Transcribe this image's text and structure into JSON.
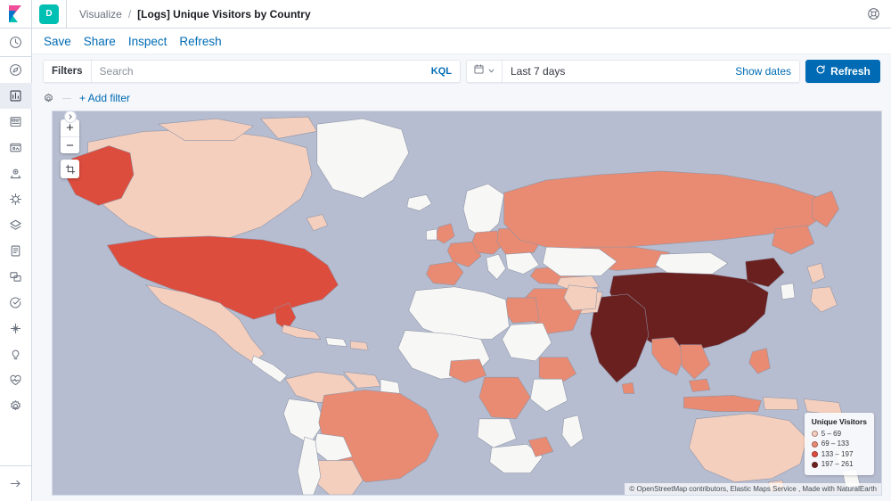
{
  "sidebar": {
    "logo_icon": "kibana-logo-icon",
    "items": [
      {
        "name": "recently-viewed",
        "icon": "clock-icon",
        "active": false
      },
      {
        "name": "discover",
        "icon": "compass-icon",
        "active": false
      },
      {
        "name": "visualize",
        "icon": "bar-chart-icon",
        "active": true
      },
      {
        "name": "dashboard",
        "icon": "dashboard-icon",
        "active": false
      },
      {
        "name": "canvas",
        "icon": "canvas-icon",
        "active": false
      },
      {
        "name": "maps",
        "icon": "map-marker-icon",
        "active": false
      },
      {
        "name": "machine-learning",
        "icon": "machine-learning-icon",
        "active": false
      },
      {
        "name": "infrastructure",
        "icon": "infrastructure-icon",
        "active": false
      },
      {
        "name": "logs",
        "icon": "logs-icon",
        "active": false
      },
      {
        "name": "apm",
        "icon": "apm-icon",
        "active": false
      },
      {
        "name": "uptime",
        "icon": "uptime-icon",
        "active": false
      },
      {
        "name": "siem",
        "icon": "siem-icon",
        "active": false
      },
      {
        "name": "dev-tools",
        "icon": "wrench-icon",
        "active": false
      },
      {
        "name": "monitoring",
        "icon": "heart-pulse-icon",
        "active": false
      },
      {
        "name": "management",
        "icon": "gear-icon",
        "active": false
      }
    ],
    "collapse_icon": "arrow-right-icon"
  },
  "header": {
    "space_badge": "D",
    "breadcrumbs": [
      {
        "label": "Visualize",
        "current": false
      },
      {
        "label": "[Logs] Unique Visitors by Country",
        "current": true
      }
    ],
    "breadcrumb_separator": "/",
    "help_icon": "help-lifebuoy-icon"
  },
  "app_menu": {
    "items": [
      {
        "label": "Save",
        "name": "save"
      },
      {
        "label": "Share",
        "name": "share"
      },
      {
        "label": "Inspect",
        "name": "inspect"
      },
      {
        "label": "Refresh",
        "name": "refresh"
      }
    ]
  },
  "query_bar": {
    "filters_label": "Filters",
    "search_placeholder": "Search",
    "search_value": "",
    "query_language": "KQL",
    "calendar_icon": "calendar-icon",
    "chevron_icon": "chevron-down-icon",
    "time_range": "Last 7 days",
    "show_dates_label": "Show dates",
    "refresh_label": "Refresh",
    "refresh_icon": "refresh-icon",
    "refresh_color": "#006bb4"
  },
  "filter_bar": {
    "settings_icon": "gear-icon",
    "add_filter_label": "+ Add filter"
  },
  "map": {
    "panel_toggle_icon": "chevron-right-circle-icon",
    "zoom_in_label": "+",
    "zoom_out_label": "−",
    "fit_bounds_icon": "crop-fit-icon",
    "ocean_color": "#b6bdd0",
    "no_data_color": "#f7f7f5",
    "attribution": "© OpenStreetMap contributors, Elastic Maps Service , Made with NaturalEarth"
  },
  "legend": {
    "title": "Unique Visitors",
    "bands": [
      {
        "label": "5 – 69",
        "color": "#f4cfbe"
      },
      {
        "label": "69 – 133",
        "color": "#e98b73"
      },
      {
        "label": "133 – 197",
        "color": "#dd4d3e"
      },
      {
        "label": "197 – 261",
        "color": "#6b2020"
      }
    ]
  },
  "chart_data": {
    "type": "map",
    "title": "[Logs] Unique Visitors by Country",
    "metric": "Unique Visitors",
    "legend_bands": [
      "5 – 69",
      "69 – 133",
      "133 – 197",
      "197 – 261"
    ],
    "band_colors": [
      "#f4cfbe",
      "#e98b73",
      "#dd4d3e",
      "#6b2020"
    ],
    "countries": [
      {
        "name": "China",
        "band": 4
      },
      {
        "name": "India",
        "band": 4
      },
      {
        "name": "United States",
        "band": 3
      },
      {
        "name": "Alaska (US)",
        "band": 3
      },
      {
        "name": "Russia",
        "band": 2
      },
      {
        "name": "Canada",
        "band": 1
      },
      {
        "name": "Brazil",
        "band": 2
      },
      {
        "name": "Mexico",
        "band": 1
      },
      {
        "name": "Argentina",
        "band": 1
      },
      {
        "name": "Colombia",
        "band": 1
      },
      {
        "name": "Australia",
        "band": 1
      },
      {
        "name": "Indonesia",
        "band": 2
      },
      {
        "name": "Japan",
        "band": 1
      },
      {
        "name": "Turkey",
        "band": 2
      },
      {
        "name": "Nigeria",
        "band": 2
      },
      {
        "name": "DR Congo",
        "band": 2
      },
      {
        "name": "Ethiopia",
        "band": 2
      },
      {
        "name": "Egypt",
        "band": 2
      },
      {
        "name": "Saudi Arabia",
        "band": 2
      },
      {
        "name": "Spain",
        "band": 2
      },
      {
        "name": "France",
        "band": 2
      },
      {
        "name": "Germany",
        "band": 2
      },
      {
        "name": "Poland",
        "band": 2
      },
      {
        "name": "Ukraine",
        "band": 2
      },
      {
        "name": "Greenland",
        "band": 0
      },
      {
        "name": "Kazakhstan",
        "band": 0
      },
      {
        "name": "Mongolia",
        "band": 0
      },
      {
        "name": "Algeria",
        "band": 0
      },
      {
        "name": "Libya",
        "band": 0
      },
      {
        "name": "Sudan",
        "band": 0
      },
      {
        "name": "Peru",
        "band": 0
      },
      {
        "name": "Chile",
        "band": 0
      }
    ]
  }
}
